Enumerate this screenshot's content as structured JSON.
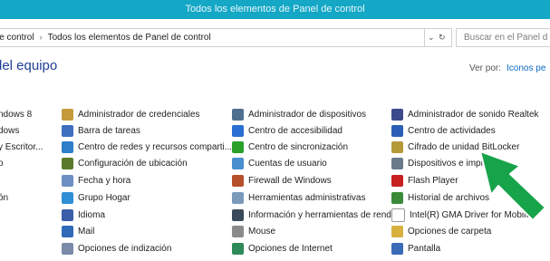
{
  "window": {
    "title": "Todos los elementos de Panel de control"
  },
  "address": {
    "crumb_1": "le control",
    "crumb_2": "Todos los elementos de Panel de control",
    "separator_glyph": "›",
    "dropdown_glyph": "⌄",
    "refresh_glyph": "↻",
    "search_placeholder": "Buscar en el Panel d"
  },
  "heading": "del equipo",
  "view_by": {
    "label": "Ver por:",
    "value": "Iconos pe"
  },
  "columns": {
    "col0": [
      {
        "label": "ndows 8"
      },
      {
        "label": "dows"
      },
      {
        "label": "y Escritor..."
      },
      {
        "label": "o"
      },
      {
        "label": ""
      },
      {
        "label": "ón"
      },
      {
        "label": ""
      },
      {
        "label": ""
      }
    ],
    "col1": [
      {
        "label": "Administrador de credenciales",
        "icon": "credential-manager-icon",
        "color": "#c49a3a"
      },
      {
        "label": "Barra de tareas",
        "icon": "taskbar-icon",
        "color": "#3f6fbf"
      },
      {
        "label": "Centro de redes y recursos comparti...",
        "icon": "network-center-icon",
        "color": "#2d7fc9"
      },
      {
        "label": "Configuración de ubicación",
        "icon": "location-settings-icon",
        "color": "#5a7a2a"
      },
      {
        "label": "Fecha y hora",
        "icon": "date-time-icon",
        "color": "#6e8fc1"
      },
      {
        "label": "Grupo Hogar",
        "icon": "homegroup-icon",
        "color": "#2f8fd6"
      },
      {
        "label": "Idioma",
        "icon": "language-icon",
        "color": "#3a5ea8"
      },
      {
        "label": "Mail",
        "icon": "mail-icon",
        "color": "#2f6ab8"
      },
      {
        "label": "Opciones de indización",
        "icon": "indexing-options-icon",
        "color": "#7a8aa8"
      }
    ],
    "col2": [
      {
        "label": "Administrador de dispositivos",
        "icon": "device-manager-icon",
        "color": "#4f6f8f"
      },
      {
        "label": "Centro de accesibilidad",
        "icon": "ease-of-access-icon",
        "color": "#2a6fd1"
      },
      {
        "label": "Centro de sincronización",
        "icon": "sync-center-icon",
        "color": "#2aa02a"
      },
      {
        "label": "Cuentas de usuario",
        "icon": "user-accounts-icon",
        "color": "#4a8fd0"
      },
      {
        "label": "Firewall de Windows",
        "icon": "windows-firewall-icon",
        "color": "#b5502a"
      },
      {
        "label": "Herramientas administrativas",
        "icon": "admin-tools-icon",
        "color": "#7a9aba"
      },
      {
        "label": "Información y herramientas de rendi...",
        "icon": "performance-info-icon",
        "color": "#3a4a5a"
      },
      {
        "label": "Mouse",
        "icon": "mouse-icon",
        "color": "#8a8a8a"
      },
      {
        "label": "Opciones de Internet",
        "icon": "internet-options-icon",
        "color": "#2f8a5a"
      }
    ],
    "col3": [
      {
        "label": "Administrador de sonido Realtek",
        "icon": "realtek-audio-icon",
        "color": "#3a4a8a"
      },
      {
        "label": "Centro de actividades",
        "icon": "action-center-icon",
        "color": "#2a5fb5"
      },
      {
        "label": "Cifrado de unidad BitLocker",
        "icon": "bitlocker-icon",
        "color": "#b59a3a"
      },
      {
        "label": "Dispositivos e impresoras",
        "icon": "devices-printers-icon",
        "color": "#6a7a8a"
      },
      {
        "label": "Flash Player",
        "icon": "flash-player-icon",
        "color": "#c82020"
      },
      {
        "label": "Historial de archivos",
        "icon": "file-history-icon",
        "color": "#3a8a3a"
      },
      {
        "label": "Intel(R) GMA Driver for Mobile",
        "icon": "intel-gma-icon",
        "color": "#ffffff"
      },
      {
        "label": "Opciones de carpeta",
        "icon": "folder-options-icon",
        "color": "#d8b040"
      },
      {
        "label": "Pantalla",
        "icon": "display-icon",
        "color": "#3a6ab8"
      }
    ]
  },
  "pointer": {
    "icon": "green-arrow-pointer-icon",
    "color": "#17a34a"
  }
}
